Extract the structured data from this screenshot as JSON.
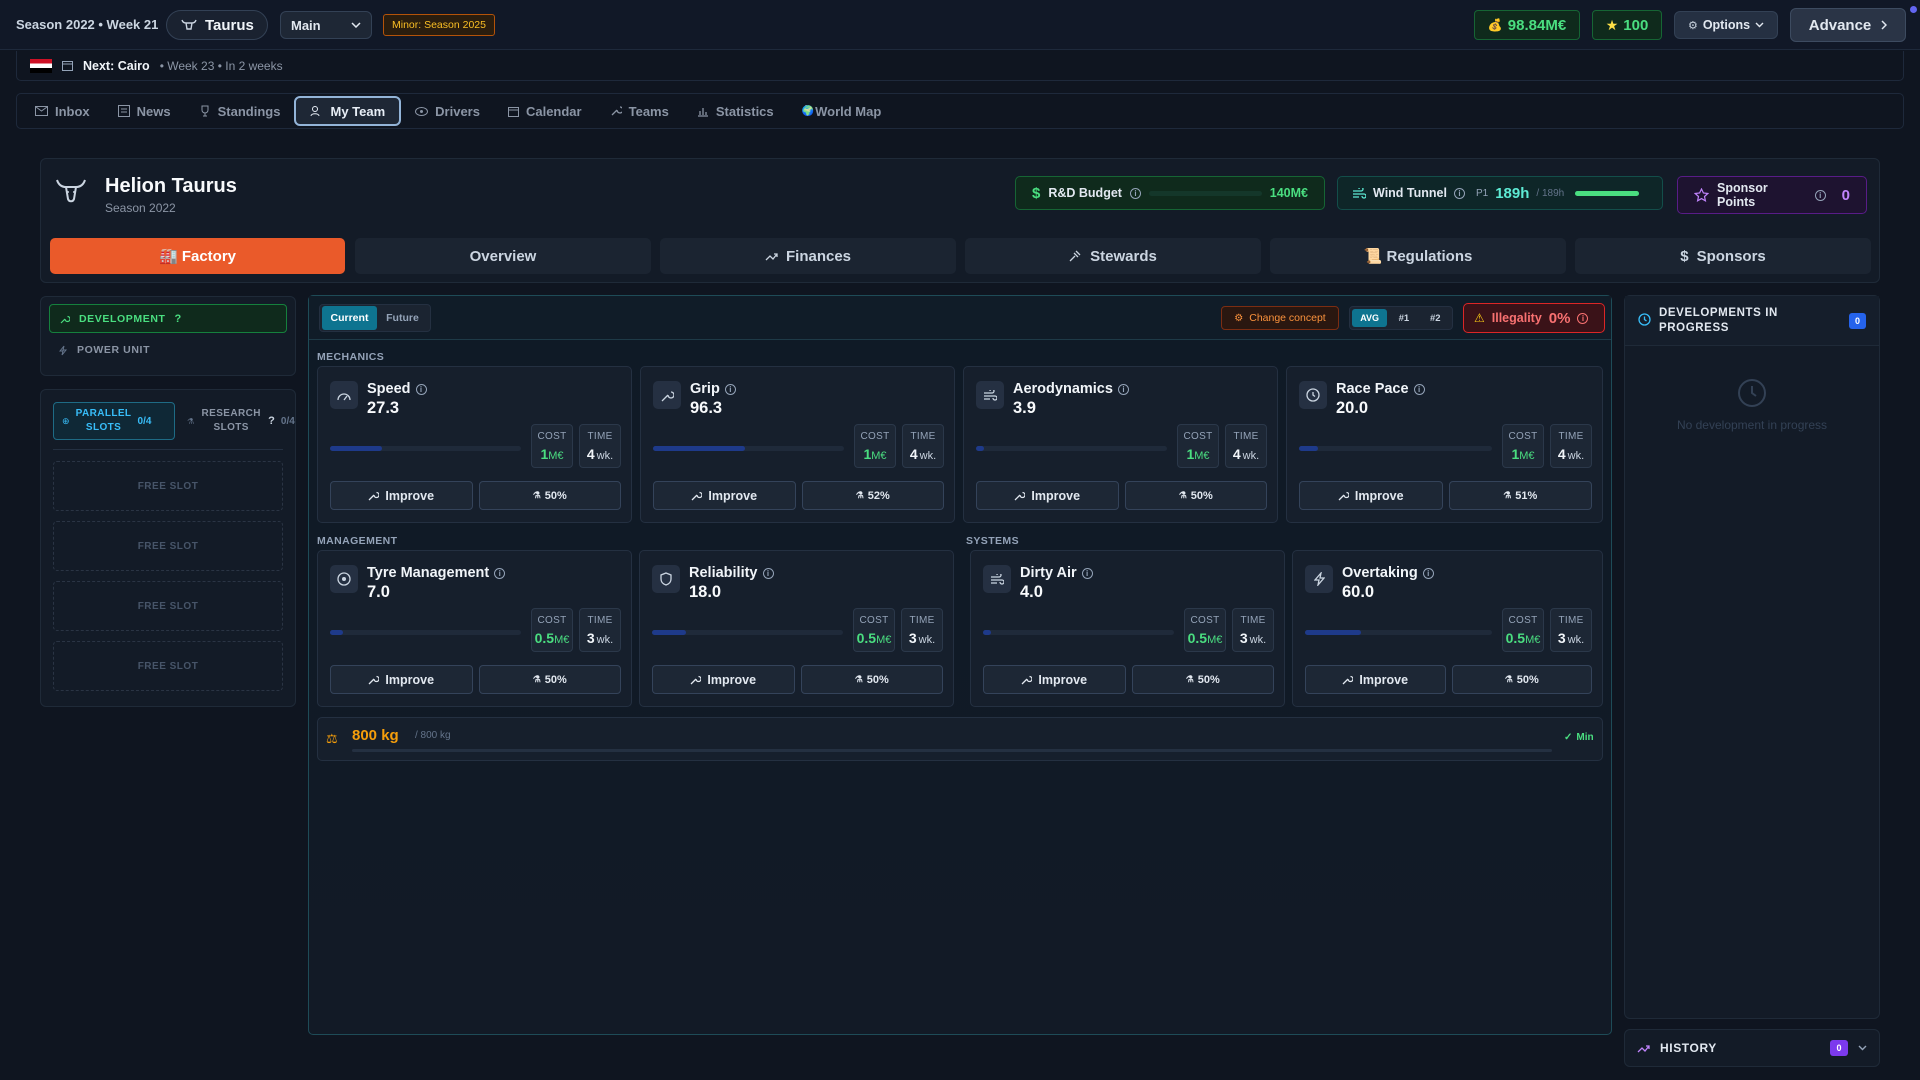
{
  "topbar": {
    "season_week": "Season 2022 • Week 21",
    "team_short": "Taurus",
    "mode_select": "Main",
    "minor_badge": "Minor: Season 2025",
    "money": "98.84M€",
    "stars": "100",
    "options_label": "Options",
    "advance_label": "Advance"
  },
  "next_bar": {
    "label": "Next: Cairo",
    "detail": "• Week 23 • In 2 weeks"
  },
  "nav": [
    {
      "label": "Inbox",
      "icon": "mail-icon"
    },
    {
      "label": "News",
      "icon": "newspaper-icon"
    },
    {
      "label": "Standings",
      "icon": "trophy-icon"
    },
    {
      "label": "My Team",
      "icon": "users-icon"
    },
    {
      "label": "Drivers",
      "icon": "eye-icon"
    },
    {
      "label": "Calendar",
      "icon": "calendar-icon"
    },
    {
      "label": "Teams",
      "icon": "wrench-icon"
    },
    {
      "label": "Statistics",
      "icon": "bar-chart-icon"
    },
    {
      "label": "World Map",
      "icon": "globe-icon"
    }
  ],
  "team": {
    "name": "Helion Taurus",
    "season": "Season 2022"
  },
  "rnd_budget": {
    "label": "R&D Budget",
    "value": "140M€",
    "fill": 0.0
  },
  "wind_tunnel": {
    "label": "Wind Tunnel",
    "pos": "P1",
    "value": "189h",
    "max": "/ 189h",
    "fill": 1.0
  },
  "sponsor_points": {
    "label": "Sponsor Points",
    "value": "0"
  },
  "tabs": [
    "🏭 Factory",
    "Overview",
    "Finances",
    "Stewards",
    "📜 Regulations",
    "Sponsors"
  ],
  "left": {
    "development": "DEVELOPMENT",
    "power_unit": "POWER UNIT",
    "parallel_slots": "PARALLEL SLOTS",
    "parallel_count": "0/4",
    "research_slots": "RESEARCH SLOTS",
    "research_count": "0/4",
    "question": "?",
    "free_slot": "FREE SLOT"
  },
  "main": {
    "current_tab": "Current",
    "future_tab": "Future",
    "change_concept": "Change concept",
    "avg": "AVG",
    "n1": "#1",
    "n2": "#2",
    "illegality_label": "Illegality",
    "illegality_value": "0%",
    "mechanics_label": "MECHANICS",
    "management_label": "MANAGEMENT",
    "systems_label": "SYSTEMS",
    "cost_label": "COST",
    "time_label": "TIME",
    "improve_label": "Improve",
    "weight_value": "800 kg",
    "weight_max": "/ 800 kg",
    "weight_min": "Min"
  },
  "stats": [
    {
      "name": "Speed",
      "value": "27.3",
      "cost": "1",
      "cost_unit": "M€",
      "time": "4",
      "time_unit": "wk.",
      "chance": "50%",
      "fill": 0.27,
      "icon": "gauge-icon"
    },
    {
      "name": "Grip",
      "value": "96.3",
      "cost": "1",
      "cost_unit": "M€",
      "time": "4",
      "time_unit": "wk.",
      "chance": "52%",
      "fill": 0.48,
      "icon": "wrench-icon"
    },
    {
      "name": "Aerodynamics",
      "value": "3.9",
      "cost": "1",
      "cost_unit": "M€",
      "time": "4",
      "time_unit": "wk.",
      "chance": "50%",
      "fill": 0.04,
      "icon": "wind-icon"
    },
    {
      "name": "Race Pace",
      "value": "20.0",
      "cost": "1",
      "cost_unit": "M€",
      "time": "4",
      "time_unit": "wk.",
      "chance": "51%",
      "fill": 0.1,
      "icon": "clock-icon"
    },
    {
      "name": "Tyre Management",
      "value": "7.0",
      "cost": "0.5",
      "cost_unit": "M€",
      "time": "3",
      "time_unit": "wk.",
      "chance": "50%",
      "fill": 0.07,
      "icon": "tyre-icon"
    },
    {
      "name": "Reliability",
      "value": "18.0",
      "cost": "0.5",
      "cost_unit": "M€",
      "time": "3",
      "time_unit": "wk.",
      "chance": "50%",
      "fill": 0.18,
      "icon": "shield-icon"
    },
    {
      "name": "Dirty Air",
      "value": "4.0",
      "cost": "0.5",
      "cost_unit": "M€",
      "time": "3",
      "time_unit": "wk.",
      "chance": "50%",
      "fill": 0.04,
      "icon": "wind-icon"
    },
    {
      "name": "Overtaking",
      "value": "60.0",
      "cost": "0.5",
      "cost_unit": "M€",
      "time": "3",
      "time_unit": "wk.",
      "chance": "50%",
      "fill": 0.3,
      "icon": "bolt-icon"
    }
  ],
  "right": {
    "dev_title": "DEVELOPMENTS IN PROGRESS",
    "dev_count": "0",
    "empty_text": "No development in progress",
    "history_label": "HISTORY",
    "history_count": "0"
  },
  "colors": {
    "accent_orange": "#ea5a2a",
    "money_green": "#4ade80",
    "accent_teal": "#2dd4bf",
    "purple": "#a855f7",
    "danger_red": "#f87171"
  }
}
